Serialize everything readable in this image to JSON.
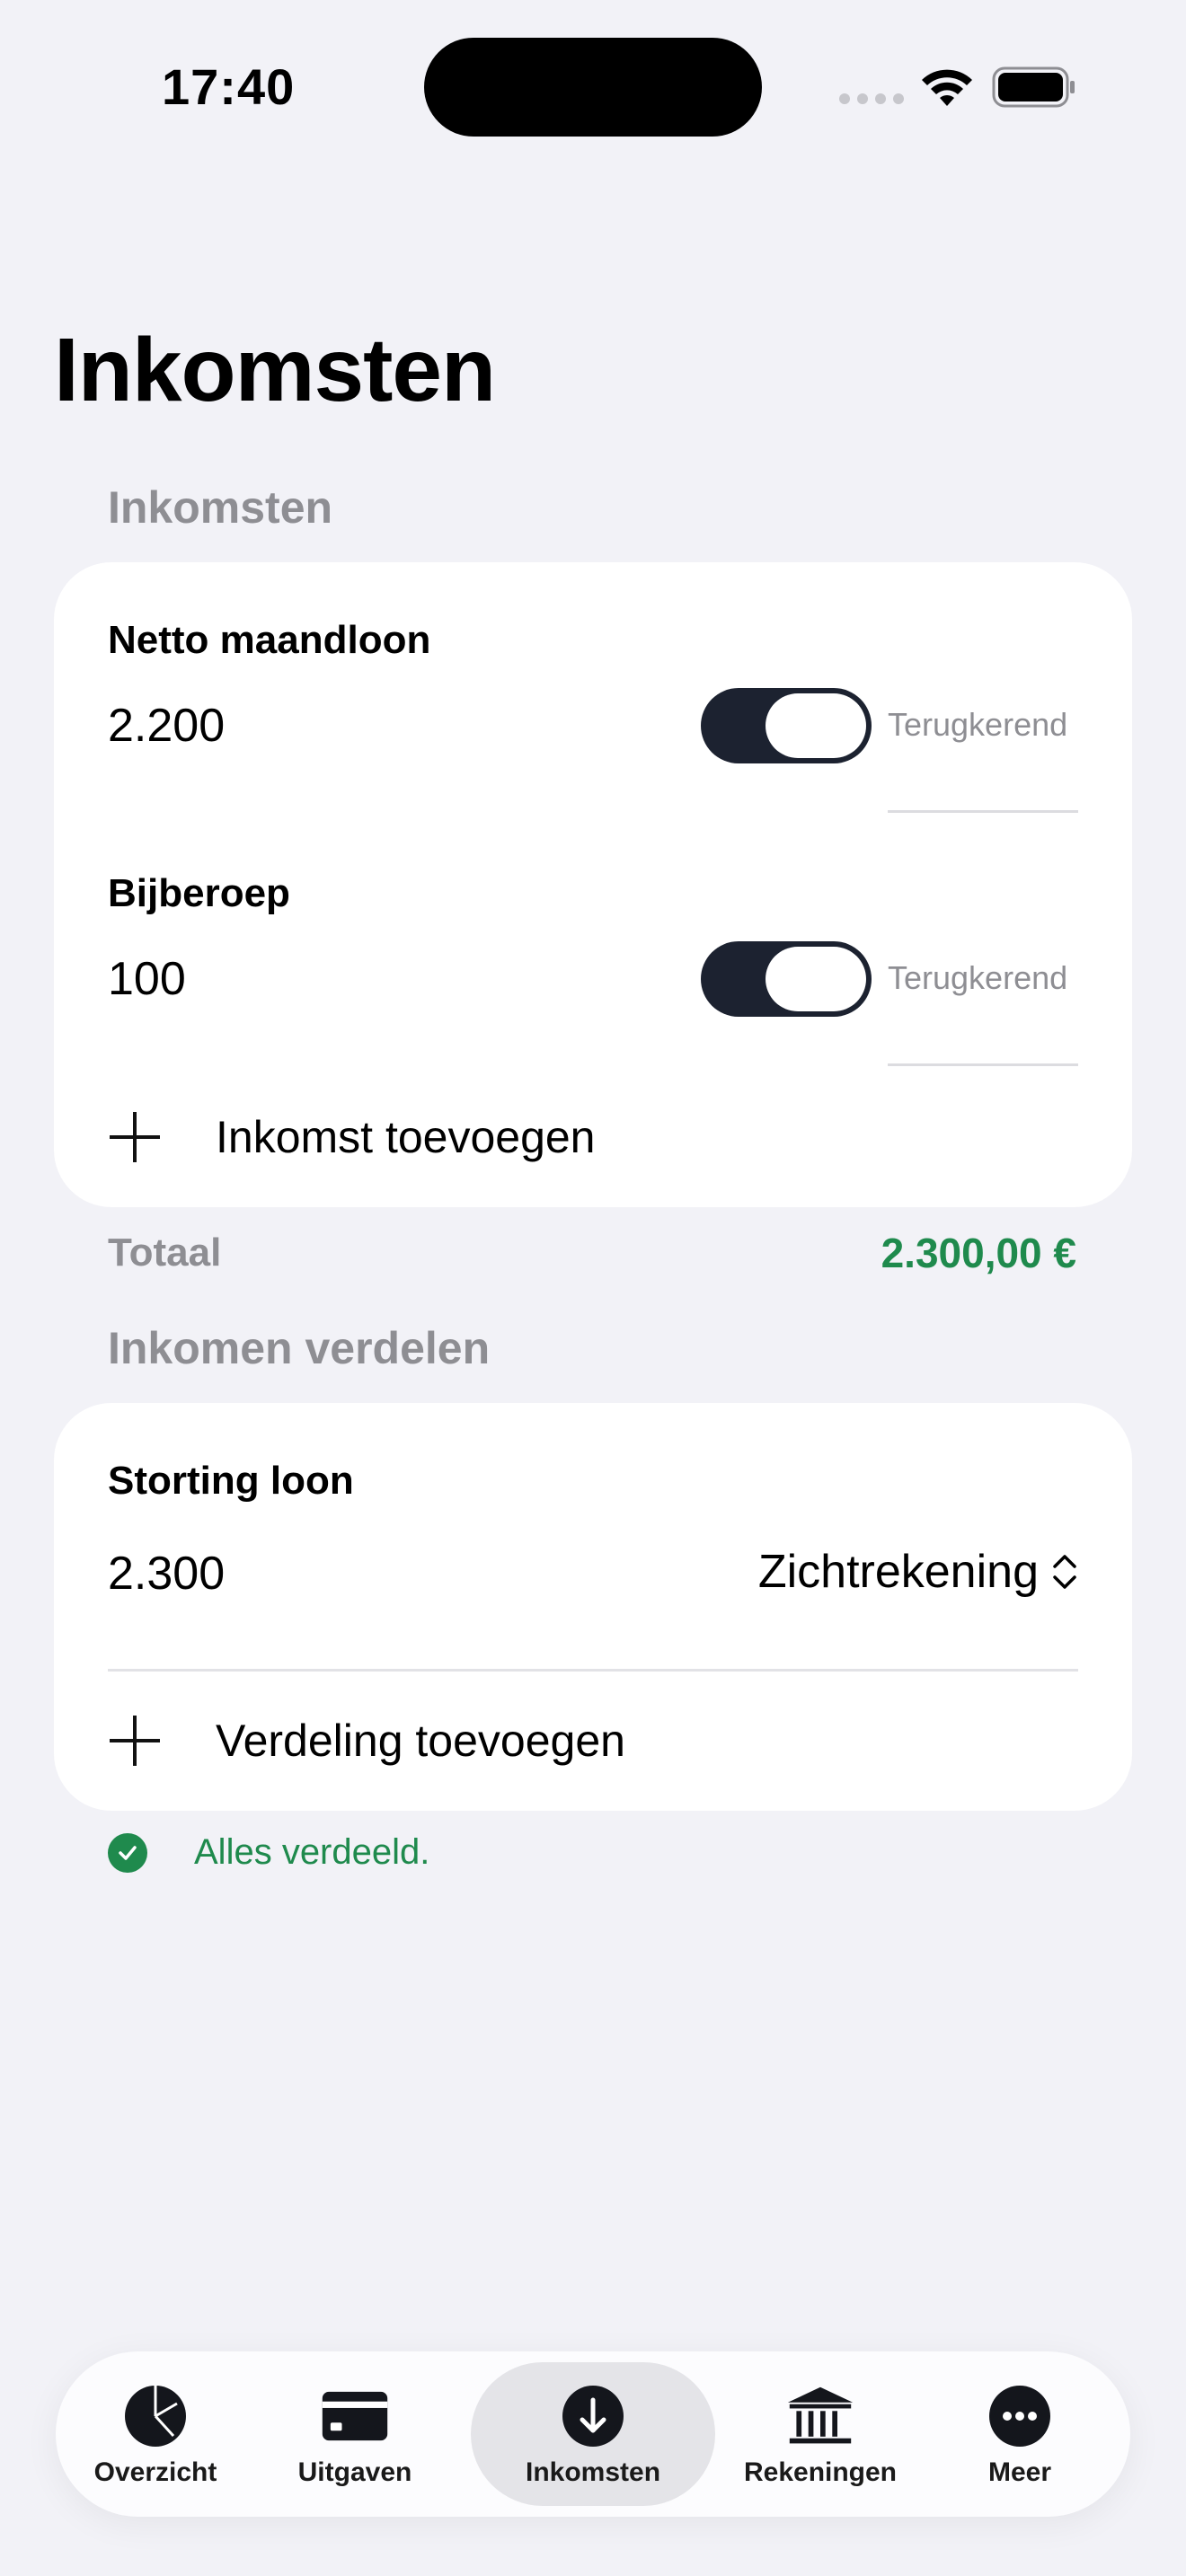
{
  "status_bar": {
    "time": "17:40"
  },
  "page": {
    "title": "Inkomsten"
  },
  "income": {
    "section_label": "Inkomsten",
    "items": [
      {
        "name": "Netto maandloon",
        "amount": "2.200",
        "toggle_label": "Terugkerend",
        "recurring": true
      },
      {
        "name": "Bijberoep",
        "amount": "100",
        "toggle_label": "Terugkerend",
        "recurring": true
      }
    ],
    "add_label": "Inkomst toevoegen",
    "total_label": "Totaal",
    "total_value": "2.300,00 €"
  },
  "distribution": {
    "section_label": "Inkomen verdelen",
    "items": [
      {
        "name": "Storting loon",
        "amount": "2.300",
        "account": "Zichtrekening"
      }
    ],
    "add_label": "Verdeling toevoegen",
    "status_text": "Alles verdeeld."
  },
  "tabbar": {
    "tabs": [
      {
        "label": "Overzicht",
        "icon": "pie-chart-icon"
      },
      {
        "label": "Uitgaven",
        "icon": "credit-card-icon"
      },
      {
        "label": "Inkomsten",
        "icon": "arrow-down-circle-icon",
        "active": true
      },
      {
        "label": "Rekeningen",
        "icon": "bank-icon"
      },
      {
        "label": "Meer",
        "icon": "more-icon"
      }
    ]
  },
  "colors": {
    "accent_green": "#1f8a4d",
    "toggle_on": "#1c2230",
    "background": "#f2f2f7"
  }
}
